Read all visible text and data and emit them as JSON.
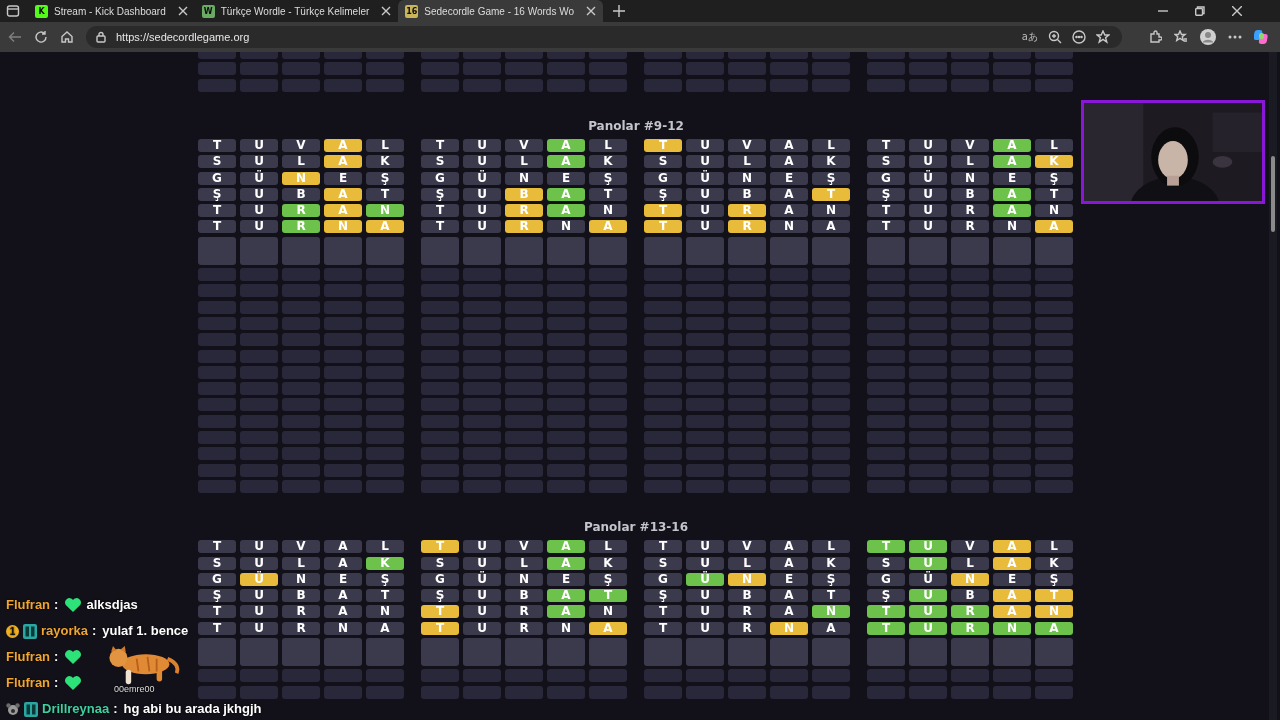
{
  "browser": {
    "tabs": [
      {
        "title": "Stream - Kick Dashboard",
        "icon_text": "K",
        "color": "#53fc18",
        "selected": false
      },
      {
        "title": "Türkçe Wordle - Türkçe Kelimeler",
        "icon_text": "W",
        "color": "#6aaa64",
        "selected": false
      },
      {
        "title": "Sedecordle Game - 16 Words Wo",
        "icon_text": "16",
        "color": "#c9b458",
        "selected": true
      }
    ],
    "url": "https://sedecordlegame.org",
    "read_aloud": "aあ"
  },
  "sections": [
    {
      "title": "Panolar #9-12",
      "boards": [
        {
          "rows": [
            {
              "tiles": [
                {
                  "letter": "T",
                  "color": "#3b3a4d"
                },
                {
                  "letter": "U",
                  "color": "#3b3a4d"
                },
                {
                  "letter": "V",
                  "color": "#3b3a4d"
                },
                {
                  "letter": "A",
                  "color": "#e8bb3a"
                },
                {
                  "letter": "L",
                  "color": "#3b3a4d"
                }
              ]
            },
            {
              "tiles": [
                {
                  "letter": "S",
                  "color": "#3b3a4d"
                },
                {
                  "letter": "U",
                  "color": "#3b3a4d"
                },
                {
                  "letter": "L",
                  "color": "#3b3a4d"
                },
                {
                  "letter": "A",
                  "color": "#e8bb3a"
                },
                {
                  "letter": "K",
                  "color": "#3b3a4d"
                }
              ]
            },
            {
              "tiles": [
                {
                  "letter": "G",
                  "color": "#3b3a4d"
                },
                {
                  "letter": "Ü",
                  "color": "#3b3a4d"
                },
                {
                  "letter": "N",
                  "color": "#e8bb3a"
                },
                {
                  "letter": "E",
                  "color": "#3b3a4d"
                },
                {
                  "letter": "Ş",
                  "color": "#3b3a4d"
                }
              ]
            },
            {
              "tiles": [
                {
                  "letter": "Ş",
                  "color": "#3b3a4d"
                },
                {
                  "letter": "U",
                  "color": "#3b3a4d"
                },
                {
                  "letter": "B",
                  "color": "#3b3a4d"
                },
                {
                  "letter": "A",
                  "color": "#e8bb3a"
                },
                {
                  "letter": "T",
                  "color": "#3b3a4d"
                }
              ]
            },
            {
              "tiles": [
                {
                  "letter": "T",
                  "color": "#3b3a4d"
                },
                {
                  "letter": "U",
                  "color": "#3b3a4d"
                },
                {
                  "letter": "R",
                  "color": "#6cc24a"
                },
                {
                  "letter": "A",
                  "color": "#e8bb3a"
                },
                {
                  "letter": "N",
                  "color": "#6cc24a"
                }
              ]
            },
            {
              "tiles": [
                {
                  "letter": "T",
                  "color": "#3b3a4d"
                },
                {
                  "letter": "U",
                  "color": "#3b3a4d"
                },
                {
                  "letter": "R",
                  "color": "#6cc24a"
                },
                {
                  "letter": "N",
                  "color": "#e8bb3a"
                },
                {
                  "letter": "A",
                  "color": "#e8bb3a"
                }
              ]
            }
          ]
        },
        {
          "rows": [
            {
              "tiles": [
                {
                  "letter": "T",
                  "color": "#3b3a4d"
                },
                {
                  "letter": "U",
                  "color": "#3b3a4d"
                },
                {
                  "letter": "V",
                  "color": "#3b3a4d"
                },
                {
                  "letter": "A",
                  "color": "#6cc24a"
                },
                {
                  "letter": "L",
                  "color": "#3b3a4d"
                }
              ]
            },
            {
              "tiles": [
                {
                  "letter": "S",
                  "color": "#3b3a4d"
                },
                {
                  "letter": "U",
                  "color": "#3b3a4d"
                },
                {
                  "letter": "L",
                  "color": "#3b3a4d"
                },
                {
                  "letter": "A",
                  "color": "#6cc24a"
                },
                {
                  "letter": "K",
                  "color": "#3b3a4d"
                }
              ]
            },
            {
              "tiles": [
                {
                  "letter": "G",
                  "color": "#3b3a4d"
                },
                {
                  "letter": "Ü",
                  "color": "#3b3a4d"
                },
                {
                  "letter": "N",
                  "color": "#3b3a4d"
                },
                {
                  "letter": "E",
                  "color": "#3b3a4d"
                },
                {
                  "letter": "Ş",
                  "color": "#3b3a4d"
                }
              ]
            },
            {
              "tiles": [
                {
                  "letter": "Ş",
                  "color": "#3b3a4d"
                },
                {
                  "letter": "U",
                  "color": "#3b3a4d"
                },
                {
                  "letter": "B",
                  "color": "#e8bb3a"
                },
                {
                  "letter": "A",
                  "color": "#6cc24a"
                },
                {
                  "letter": "T",
                  "color": "#3b3a4d"
                }
              ]
            },
            {
              "tiles": [
                {
                  "letter": "T",
                  "color": "#3b3a4d"
                },
                {
                  "letter": "U",
                  "color": "#3b3a4d"
                },
                {
                  "letter": "R",
                  "color": "#e8bb3a"
                },
                {
                  "letter": "A",
                  "color": "#6cc24a"
                },
                {
                  "letter": "N",
                  "color": "#3b3a4d"
                }
              ]
            },
            {
              "tiles": [
                {
                  "letter": "T",
                  "color": "#3b3a4d"
                },
                {
                  "letter": "U",
                  "color": "#3b3a4d"
                },
                {
                  "letter": "R",
                  "color": "#e8bb3a"
                },
                {
                  "letter": "N",
                  "color": "#3b3a4d"
                },
                {
                  "letter": "A",
                  "color": "#e8bb3a"
                }
              ]
            }
          ]
        },
        {
          "rows": [
            {
              "tiles": [
                {
                  "letter": "T",
                  "color": "#e8bb3a"
                },
                {
                  "letter": "U",
                  "color": "#3b3a4d"
                },
                {
                  "letter": "V",
                  "color": "#3b3a4d"
                },
                {
                  "letter": "A",
                  "color": "#3b3a4d"
                },
                {
                  "letter": "L",
                  "color": "#3b3a4d"
                }
              ]
            },
            {
              "tiles": [
                {
                  "letter": "S",
                  "color": "#3b3a4d"
                },
                {
                  "letter": "U",
                  "color": "#3b3a4d"
                },
                {
                  "letter": "L",
                  "color": "#3b3a4d"
                },
                {
                  "letter": "A",
                  "color": "#3b3a4d"
                },
                {
                  "letter": "K",
                  "color": "#3b3a4d"
                }
              ]
            },
            {
              "tiles": [
                {
                  "letter": "G",
                  "color": "#3b3a4d"
                },
                {
                  "letter": "Ü",
                  "color": "#3b3a4d"
                },
                {
                  "letter": "N",
                  "color": "#3b3a4d"
                },
                {
                  "letter": "E",
                  "color": "#3b3a4d"
                },
                {
                  "letter": "Ş",
                  "color": "#3b3a4d"
                }
              ]
            },
            {
              "tiles": [
                {
                  "letter": "Ş",
                  "color": "#3b3a4d"
                },
                {
                  "letter": "U",
                  "color": "#3b3a4d"
                },
                {
                  "letter": "B",
                  "color": "#3b3a4d"
                },
                {
                  "letter": "A",
                  "color": "#3b3a4d"
                },
                {
                  "letter": "T",
                  "color": "#e8bb3a"
                }
              ]
            },
            {
              "tiles": [
                {
                  "letter": "T",
                  "color": "#e8bb3a"
                },
                {
                  "letter": "U",
                  "color": "#3b3a4d"
                },
                {
                  "letter": "R",
                  "color": "#e8bb3a"
                },
                {
                  "letter": "A",
                  "color": "#3b3a4d"
                },
                {
                  "letter": "N",
                  "color": "#3b3a4d"
                }
              ]
            },
            {
              "tiles": [
                {
                  "letter": "T",
                  "color": "#e8bb3a"
                },
                {
                  "letter": "U",
                  "color": "#3b3a4d"
                },
                {
                  "letter": "R",
                  "color": "#e8bb3a"
                },
                {
                  "letter": "N",
                  "color": "#3b3a4d"
                },
                {
                  "letter": "A",
                  "color": "#3b3a4d"
                }
              ]
            }
          ]
        },
        {
          "rows": [
            {
              "tiles": [
                {
                  "letter": "T",
                  "color": "#3b3a4d"
                },
                {
                  "letter": "U",
                  "color": "#3b3a4d"
                },
                {
                  "letter": "V",
                  "color": "#3b3a4d"
                },
                {
                  "letter": "A",
                  "color": "#6cc24a"
                },
                {
                  "letter": "L",
                  "color": "#3b3a4d"
                }
              ]
            },
            {
              "tiles": [
                {
                  "letter": "S",
                  "color": "#3b3a4d"
                },
                {
                  "letter": "U",
                  "color": "#3b3a4d"
                },
                {
                  "letter": "L",
                  "color": "#3b3a4d"
                },
                {
                  "letter": "A",
                  "color": "#6cc24a"
                },
                {
                  "letter": "K",
                  "color": "#e8bb3a"
                }
              ]
            },
            {
              "tiles": [
                {
                  "letter": "G",
                  "color": "#3b3a4d"
                },
                {
                  "letter": "Ü",
                  "color": "#3b3a4d"
                },
                {
                  "letter": "N",
                  "color": "#3b3a4d"
                },
                {
                  "letter": "E",
                  "color": "#3b3a4d"
                },
                {
                  "letter": "Ş",
                  "color": "#3b3a4d"
                }
              ]
            },
            {
              "tiles": [
                {
                  "letter": "Ş",
                  "color": "#3b3a4d"
                },
                {
                  "letter": "U",
                  "color": "#3b3a4d"
                },
                {
                  "letter": "B",
                  "color": "#3b3a4d"
                },
                {
                  "letter": "A",
                  "color": "#6cc24a"
                },
                {
                  "letter": "T",
                  "color": "#3b3a4d"
                }
              ]
            },
            {
              "tiles": [
                {
                  "letter": "T",
                  "color": "#3b3a4d"
                },
                {
                  "letter": "U",
                  "color": "#3b3a4d"
                },
                {
                  "letter": "R",
                  "color": "#3b3a4d"
                },
                {
                  "letter": "A",
                  "color": "#6cc24a"
                },
                {
                  "letter": "N",
                  "color": "#3b3a4d"
                }
              ]
            },
            {
              "tiles": [
                {
                  "letter": "T",
                  "color": "#3b3a4d"
                },
                {
                  "letter": "U",
                  "color": "#3b3a4d"
                },
                {
                  "letter": "R",
                  "color": "#3b3a4d"
                },
                {
                  "letter": "N",
                  "color": "#3b3a4d"
                },
                {
                  "letter": "A",
                  "color": "#e8bb3a"
                }
              ]
            }
          ]
        }
      ]
    },
    {
      "title": "Panolar #13-16",
      "boards": [
        {
          "rows": [
            {
              "tiles": [
                {
                  "letter": "T",
                  "color": "#3b3a4d"
                },
                {
                  "letter": "U",
                  "color": "#3b3a4d"
                },
                {
                  "letter": "V",
                  "color": "#3b3a4d"
                },
                {
                  "letter": "A",
                  "color": "#3b3a4d"
                },
                {
                  "letter": "L",
                  "color": "#3b3a4d"
                }
              ]
            },
            {
              "tiles": [
                {
                  "letter": "S",
                  "color": "#3b3a4d"
                },
                {
                  "letter": "U",
                  "color": "#3b3a4d"
                },
                {
                  "letter": "L",
                  "color": "#3b3a4d"
                },
                {
                  "letter": "A",
                  "color": "#3b3a4d"
                },
                {
                  "letter": "K",
                  "color": "#6cc24a"
                }
              ]
            },
            {
              "tiles": [
                {
                  "letter": "G",
                  "color": "#3b3a4d"
                },
                {
                  "letter": "Ü",
                  "color": "#e8bb3a"
                },
                {
                  "letter": "N",
                  "color": "#3b3a4d"
                },
                {
                  "letter": "E",
                  "color": "#3b3a4d"
                },
                {
                  "letter": "Ş",
                  "color": "#3b3a4d"
                }
              ]
            },
            {
              "tiles": [
                {
                  "letter": "Ş",
                  "color": "#3b3a4d"
                },
                {
                  "letter": "U",
                  "color": "#3b3a4d"
                },
                {
                  "letter": "B",
                  "color": "#3b3a4d"
                },
                {
                  "letter": "A",
                  "color": "#3b3a4d"
                },
                {
                  "letter": "T",
                  "color": "#3b3a4d"
                }
              ]
            },
            {
              "tiles": [
                {
                  "letter": "T",
                  "color": "#3b3a4d"
                },
                {
                  "letter": "U",
                  "color": "#3b3a4d"
                },
                {
                  "letter": "R",
                  "color": "#3b3a4d"
                },
                {
                  "letter": "A",
                  "color": "#3b3a4d"
                },
                {
                  "letter": "N",
                  "color": "#3b3a4d"
                }
              ]
            },
            {
              "tiles": [
                {
                  "letter": "T",
                  "color": "#3b3a4d"
                },
                {
                  "letter": "U",
                  "color": "#3b3a4d"
                },
                {
                  "letter": "R",
                  "color": "#3b3a4d"
                },
                {
                  "letter": "N",
                  "color": "#3b3a4d"
                },
                {
                  "letter": "A",
                  "color": "#3b3a4d"
                }
              ]
            }
          ]
        },
        {
          "rows": [
            {
              "tiles": [
                {
                  "letter": "T",
                  "color": "#e8bb3a"
                },
                {
                  "letter": "U",
                  "color": "#3b3a4d"
                },
                {
                  "letter": "V",
                  "color": "#3b3a4d"
                },
                {
                  "letter": "A",
                  "color": "#6cc24a"
                },
                {
                  "letter": "L",
                  "color": "#3b3a4d"
                }
              ]
            },
            {
              "tiles": [
                {
                  "letter": "S",
                  "color": "#3b3a4d"
                },
                {
                  "letter": "U",
                  "color": "#3b3a4d"
                },
                {
                  "letter": "L",
                  "color": "#3b3a4d"
                },
                {
                  "letter": "A",
                  "color": "#6cc24a"
                },
                {
                  "letter": "K",
                  "color": "#3b3a4d"
                }
              ]
            },
            {
              "tiles": [
                {
                  "letter": "G",
                  "color": "#3b3a4d"
                },
                {
                  "letter": "Ü",
                  "color": "#3b3a4d"
                },
                {
                  "letter": "N",
                  "color": "#3b3a4d"
                },
                {
                  "letter": "E",
                  "color": "#3b3a4d"
                },
                {
                  "letter": "Ş",
                  "color": "#3b3a4d"
                }
              ]
            },
            {
              "tiles": [
                {
                  "letter": "Ş",
                  "color": "#3b3a4d"
                },
                {
                  "letter": "U",
                  "color": "#3b3a4d"
                },
                {
                  "letter": "B",
                  "color": "#3b3a4d"
                },
                {
                  "letter": "A",
                  "color": "#6cc24a"
                },
                {
                  "letter": "T",
                  "color": "#6cc24a"
                }
              ]
            },
            {
              "tiles": [
                {
                  "letter": "T",
                  "color": "#e8bb3a"
                },
                {
                  "letter": "U",
                  "color": "#3b3a4d"
                },
                {
                  "letter": "R",
                  "color": "#3b3a4d"
                },
                {
                  "letter": "A",
                  "color": "#6cc24a"
                },
                {
                  "letter": "N",
                  "color": "#3b3a4d"
                }
              ]
            },
            {
              "tiles": [
                {
                  "letter": "T",
                  "color": "#e8bb3a"
                },
                {
                  "letter": "U",
                  "color": "#3b3a4d"
                },
                {
                  "letter": "R",
                  "color": "#3b3a4d"
                },
                {
                  "letter": "N",
                  "color": "#3b3a4d"
                },
                {
                  "letter": "A",
                  "color": "#e8bb3a"
                }
              ]
            }
          ]
        },
        {
          "rows": [
            {
              "tiles": [
                {
                  "letter": "T",
                  "color": "#3b3a4d"
                },
                {
                  "letter": "U",
                  "color": "#3b3a4d"
                },
                {
                  "letter": "V",
                  "color": "#3b3a4d"
                },
                {
                  "letter": "A",
                  "color": "#3b3a4d"
                },
                {
                  "letter": "L",
                  "color": "#3b3a4d"
                }
              ]
            },
            {
              "tiles": [
                {
                  "letter": "S",
                  "color": "#3b3a4d"
                },
                {
                  "letter": "U",
                  "color": "#3b3a4d"
                },
                {
                  "letter": "L",
                  "color": "#3b3a4d"
                },
                {
                  "letter": "A",
                  "color": "#3b3a4d"
                },
                {
                  "letter": "K",
                  "color": "#3b3a4d"
                }
              ]
            },
            {
              "tiles": [
                {
                  "letter": "G",
                  "color": "#3b3a4d"
                },
                {
                  "letter": "Ü",
                  "color": "#6cc24a"
                },
                {
                  "letter": "N",
                  "color": "#e8bb3a"
                },
                {
                  "letter": "E",
                  "color": "#3b3a4d"
                },
                {
                  "letter": "Ş",
                  "color": "#3b3a4d"
                }
              ]
            },
            {
              "tiles": [
                {
                  "letter": "Ş",
                  "color": "#3b3a4d"
                },
                {
                  "letter": "U",
                  "color": "#3b3a4d"
                },
                {
                  "letter": "B",
                  "color": "#3b3a4d"
                },
                {
                  "letter": "A",
                  "color": "#3b3a4d"
                },
                {
                  "letter": "T",
                  "color": "#3b3a4d"
                }
              ]
            },
            {
              "tiles": [
                {
                  "letter": "T",
                  "color": "#3b3a4d"
                },
                {
                  "letter": "U",
                  "color": "#3b3a4d"
                },
                {
                  "letter": "R",
                  "color": "#3b3a4d"
                },
                {
                  "letter": "A",
                  "color": "#3b3a4d"
                },
                {
                  "letter": "N",
                  "color": "#6cc24a"
                }
              ]
            },
            {
              "tiles": [
                {
                  "letter": "T",
                  "color": "#3b3a4d"
                },
                {
                  "letter": "U",
                  "color": "#3b3a4d"
                },
                {
                  "letter": "R",
                  "color": "#3b3a4d"
                },
                {
                  "letter": "N",
                  "color": "#e8bb3a"
                },
                {
                  "letter": "A",
                  "color": "#3b3a4d"
                }
              ]
            }
          ]
        },
        {
          "rows": [
            {
              "tiles": [
                {
                  "letter": "T",
                  "color": "#6cc24a"
                },
                {
                  "letter": "U",
                  "color": "#6cc24a"
                },
                {
                  "letter": "V",
                  "color": "#3b3a4d"
                },
                {
                  "letter": "A",
                  "color": "#e8bb3a"
                },
                {
                  "letter": "L",
                  "color": "#3b3a4d"
                }
              ]
            },
            {
              "tiles": [
                {
                  "letter": "S",
                  "color": "#3b3a4d"
                },
                {
                  "letter": "U",
                  "color": "#6cc24a"
                },
                {
                  "letter": "L",
                  "color": "#3b3a4d"
                },
                {
                  "letter": "A",
                  "color": "#e8bb3a"
                },
                {
                  "letter": "K",
                  "color": "#3b3a4d"
                }
              ]
            },
            {
              "tiles": [
                {
                  "letter": "G",
                  "color": "#3b3a4d"
                },
                {
                  "letter": "Ü",
                  "color": "#3b3a4d"
                },
                {
                  "letter": "N",
                  "color": "#e8bb3a"
                },
                {
                  "letter": "E",
                  "color": "#3b3a4d"
                },
                {
                  "letter": "Ş",
                  "color": "#3b3a4d"
                }
              ]
            },
            {
              "tiles": [
                {
                  "letter": "Ş",
                  "color": "#3b3a4d"
                },
                {
                  "letter": "U",
                  "color": "#6cc24a"
                },
                {
                  "letter": "B",
                  "color": "#3b3a4d"
                },
                {
                  "letter": "A",
                  "color": "#e8bb3a"
                },
                {
                  "letter": "T",
                  "color": "#e8bb3a"
                }
              ]
            },
            {
              "tiles": [
                {
                  "letter": "T",
                  "color": "#6cc24a"
                },
                {
                  "letter": "U",
                  "color": "#6cc24a"
                },
                {
                  "letter": "R",
                  "color": "#6cc24a"
                },
                {
                  "letter": "A",
                  "color": "#e8bb3a"
                },
                {
                  "letter": "N",
                  "color": "#e8bb3a"
                }
              ]
            },
            {
              "tiles": [
                {
                  "letter": "T",
                  "color": "#6cc24a"
                },
                {
                  "letter": "U",
                  "color": "#6cc24a"
                },
                {
                  "letter": "R",
                  "color": "#6cc24a"
                },
                {
                  "letter": "N",
                  "color": "#6cc24a"
                },
                {
                  "letter": "A",
                  "color": "#6cc24a"
                }
              ]
            }
          ]
        }
      ]
    }
  ],
  "chat": [
    {
      "user": "Flufran",
      "color": "#f0a530",
      "separator": ":",
      "emote": true,
      "text": "alksdjas"
    },
    {
      "badges": [
        {
          "kind": "rank",
          "text": "1"
        },
        {
          "kind": "sub"
        }
      ],
      "user": "rayorka",
      "color": "#f0a530",
      "separator": ":",
      "emote": false,
      "text": "yulaf 1. bence"
    },
    {
      "user": "Flufran",
      "color": "#f0a530",
      "separator": ":",
      "emote": true,
      "sticker": {
        "caption": "00emre00"
      }
    },
    {
      "user": "Flufran",
      "color": "#f0a530",
      "separator": ":",
      "emote": true
    },
    {
      "badges": [
        {
          "kind": "avatar"
        },
        {
          "kind": "sub"
        }
      ],
      "user": "Drillreynaa",
      "color": "#3fd0a0",
      "separator": ":",
      "emote": false,
      "text": "hg abi bu arada jkhgjh"
    }
  ]
}
